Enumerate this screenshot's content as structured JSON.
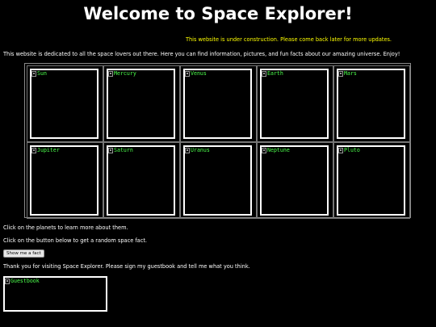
{
  "header": {
    "title": "Welcome to Space Explorer!",
    "construction_notice": "This website is under construction. Please come back later for more updates."
  },
  "intro": "This website is dedicated to all the space lovers out there. Here you can find information, pictures, and fun facts about our amazing universe. Enjoy!",
  "planets": [
    {
      "alt": "Sun"
    },
    {
      "alt": "Mercury"
    },
    {
      "alt": "Venus"
    },
    {
      "alt": "Earth"
    },
    {
      "alt": "Mars"
    },
    {
      "alt": "Jupiter"
    },
    {
      "alt": "Saturn"
    },
    {
      "alt": "Uranus"
    },
    {
      "alt": "Neptune"
    },
    {
      "alt": "Pluto"
    }
  ],
  "instructions": {
    "planets": "Click on the planets to learn more about them.",
    "fact": "Click on the button below to get a random space fact."
  },
  "fact_button_label": "Show me a fact",
  "thanks": "Thank you for visiting Space Explorer. Please sign my guestbook and tell me what you think.",
  "guestbook_alt": "Guestbook",
  "colors": {
    "background": "#000000",
    "text": "#ffffff",
    "notice": "#ffff00",
    "alt_text": "#4cff4c"
  }
}
